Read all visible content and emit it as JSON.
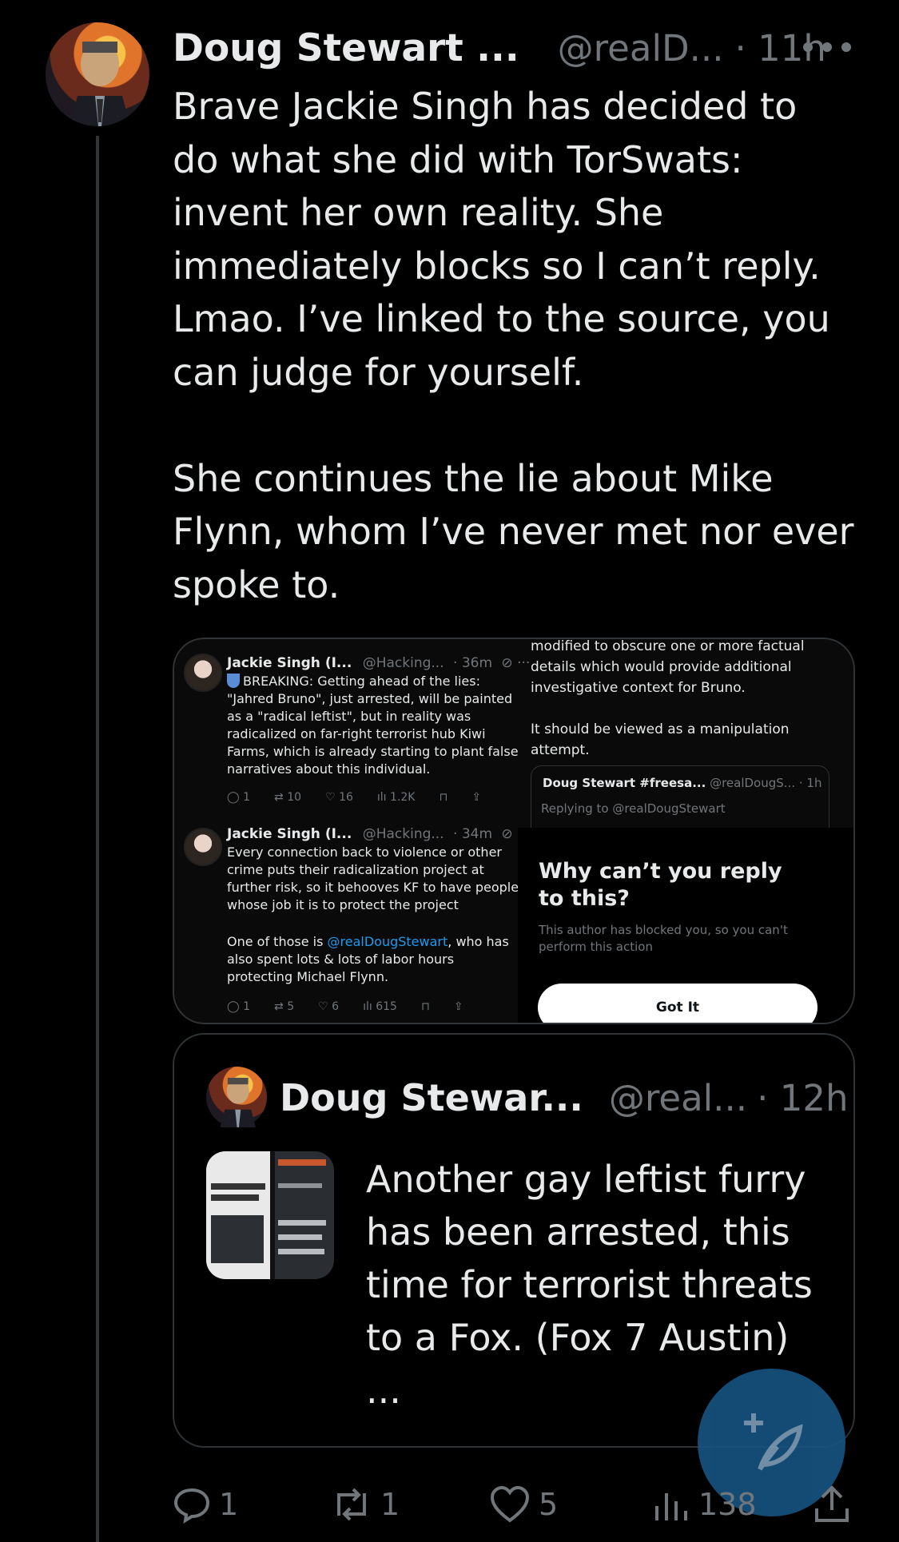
{
  "tweet": {
    "name": "Doug Stewart ...",
    "handle": "@realD...",
    "time": "· 11h",
    "text": "Brave Jackie Singh has decided to\ndo what she did with TorSwats:\ninvent her own reality. She\nimmediately blocks so I can’t reply.\nLmao. I’ve linked to the source, you\ncan judge for yourself.\n\nShe continues the lie about Mike\nFlynn, whom I’ve never met nor ever\nspoke to."
  },
  "media": {
    "post1": {
      "name": "Jackie Singh (I...",
      "handle": "@Hacking...",
      "time": "· 36m",
      "body": "BREAKING: Getting ahead of the lies:\n\"Jahred Bruno\", just arrested, will be painted\nas a \"radical leftist\", but in reality was\nradicalized on far-right terrorist hub Kiwi\nFarms, which is already starting to plant false\nnarratives about this individual.",
      "replies": "1",
      "reposts": "10",
      "likes": "16",
      "views": "1.2K"
    },
    "post2": {
      "name": "Jackie Singh (I...",
      "handle": "@Hacking...",
      "time": "· 34m",
      "body": "Every connection back to violence or other\ncrime puts their radicalization project at\nfurther risk, so it behooves KF to have people\nwhose job it is to protect the project",
      "body2_pre": "One of those is ",
      "mention": "@realDougStewart",
      "body2_post": ", who has\nalso spent lots & lots of labor hours\nprotecting Michael Flynn.",
      "replies": "1",
      "reposts": "5",
      "likes": "6",
      "views": "615"
    },
    "right_top": "modified to obscure one or more factual\ndetails which would provide additional\ninvestigative context for Bruno.\n\nIt should be viewed as a manipulation\nattempt.",
    "right_card": {
      "name": "Doug Stewart #freesa...",
      "handle": "@realDougS...",
      "time": "· 1h",
      "replying": "Replying to @realDougStewart"
    },
    "sheet": {
      "title": "Why can’t you reply to this?",
      "subtitle": "This author has blocked you, so you can't perform this action",
      "button": "Got It"
    }
  },
  "quote": {
    "name": "Doug Stewar...",
    "handle": "@real...",
    "time": "· 12h",
    "text": "Another gay leftist furry has been arrested, this time for terrorist threats to a Fox. (Fox 7 Austin) ..."
  },
  "actions": {
    "replies": "1",
    "reposts": "1",
    "likes": "5",
    "views": "138"
  }
}
